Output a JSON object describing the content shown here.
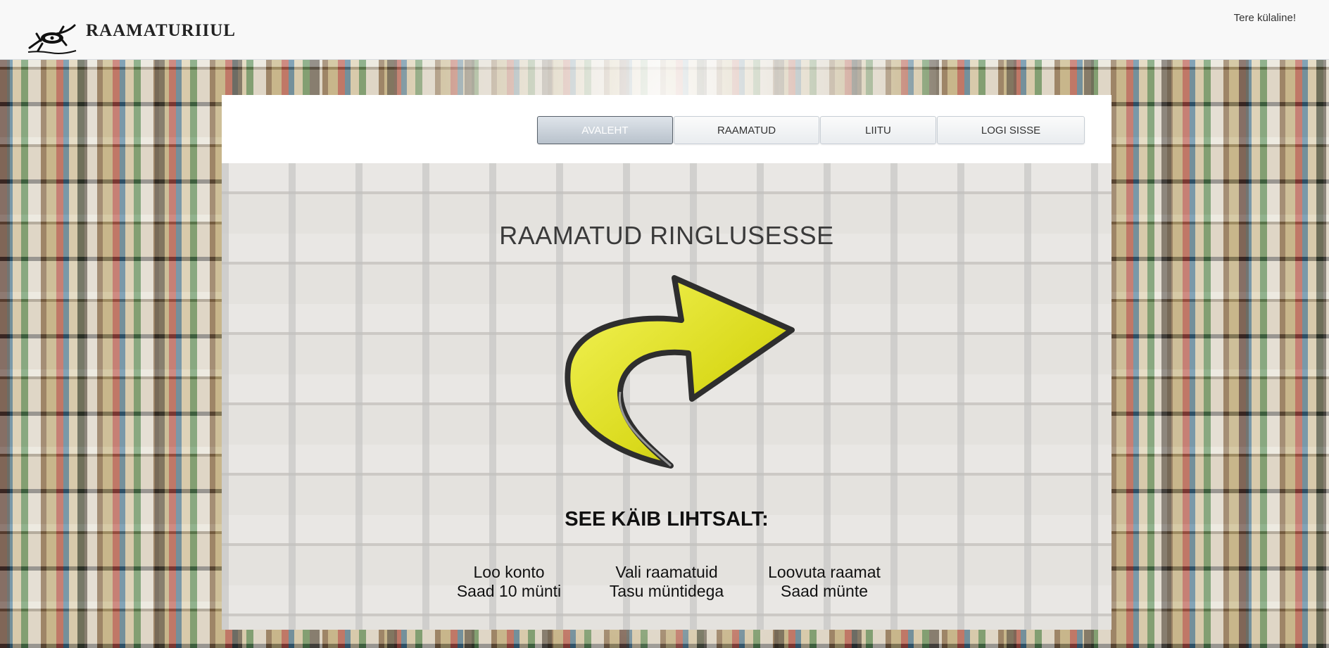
{
  "header": {
    "brand": "RAAMATURIIUL",
    "greeting": "Tere külaline!"
  },
  "nav": [
    {
      "label": "AVALEHT",
      "active": true
    },
    {
      "label": "RAAMATUD",
      "active": false
    },
    {
      "label": "LIITU",
      "active": false
    },
    {
      "label": "LOGI SISSE",
      "active": false
    }
  ],
  "hero": {
    "title": "RAAMATUD RINGLUSESSE",
    "how_title": "SEE KÄIB LIHTSALT:",
    "steps": [
      {
        "line1": "Loo konto",
        "line2": "Saad 10 münti"
      },
      {
        "line1": "Vali raamatuid",
        "line2": "Tasu müntidega"
      },
      {
        "line1": "Loovuta raamat",
        "line2": "Saad münte"
      }
    ]
  },
  "colors": {
    "arrow_fill": "#e6e62a",
    "arrow_outline": "#3a3a3a",
    "nav_active": "#b9c2cc"
  },
  "icons": {
    "logo": "lizard-logo-icon",
    "arrow": "curved-arrow-icon"
  }
}
